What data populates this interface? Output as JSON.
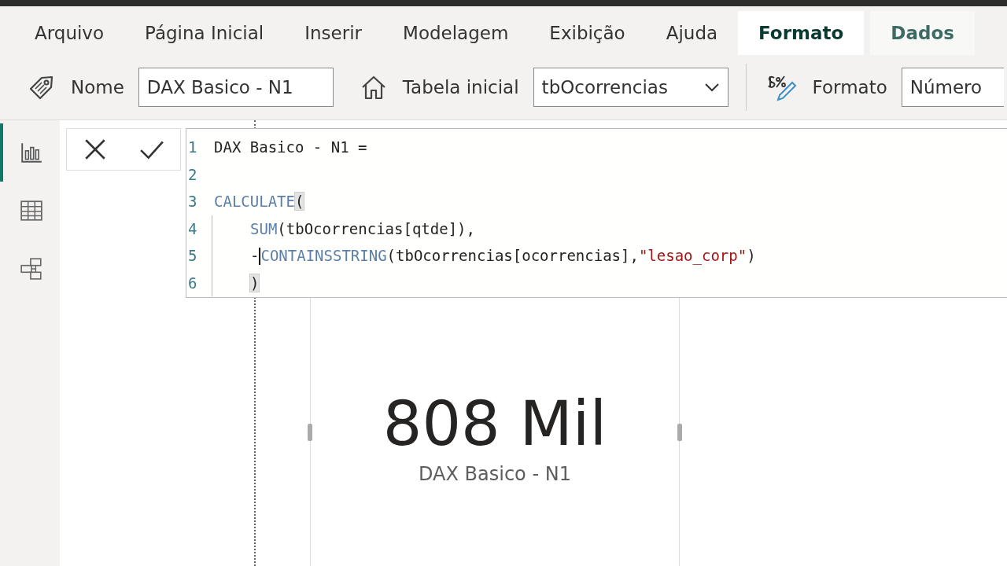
{
  "tabs": [
    {
      "label": "Arquivo",
      "selected": false,
      "contextual": false
    },
    {
      "label": "Página Inicial",
      "selected": false,
      "contextual": false
    },
    {
      "label": "Inserir",
      "selected": false,
      "contextual": false
    },
    {
      "label": "Modelagem",
      "selected": false,
      "contextual": false
    },
    {
      "label": "Exibição",
      "selected": false,
      "contextual": false
    },
    {
      "label": "Ajuda",
      "selected": false,
      "contextual": false
    },
    {
      "label": "Formato",
      "selected": true,
      "contextual": true
    },
    {
      "label": "Dados",
      "selected": false,
      "contextual": true
    }
  ],
  "toolbar": {
    "name_label": "Nome",
    "name_value": "DAX Basico - N1",
    "table_label": "Tabela inicial",
    "table_value": "tbOcorrencias",
    "format_label": "Formato",
    "format_value": "Número"
  },
  "sidebar": [
    {
      "kind": "report",
      "selected": true
    },
    {
      "kind": "data",
      "selected": false
    },
    {
      "kind": "model",
      "selected": false
    }
  ],
  "formula": {
    "lines": [
      {
        "number": "1",
        "indented": false,
        "tokens": [
          {
            "kind": "plain",
            "text": "DAX Basico - N1 ="
          }
        ]
      },
      {
        "number": "2",
        "indented": false
      },
      {
        "number": "3",
        "indented": false,
        "tokens": [
          {
            "kind": "function",
            "text": "CALCULATE"
          },
          {
            "kind": "bracket",
            "text": "("
          }
        ]
      },
      {
        "number": "4",
        "indented": true,
        "tokens": [
          {
            "kind": "function",
            "text": "SUM"
          },
          {
            "kind": "plain",
            "text": "(tbOcorrencias[qtde]),"
          }
        ]
      },
      {
        "number": "5",
        "indented": true,
        "tokens": [
          {
            "kind": "plain",
            "text": "-"
          },
          {
            "kind": "caret"
          },
          {
            "kind": "function",
            "text": "CONTAINSSTRING"
          },
          {
            "kind": "plain",
            "text": "(tbOcorrencias[ocorrencias],"
          },
          {
            "kind": "string",
            "text": "\"lesao_corp\""
          },
          {
            "kind": "plain",
            "text": ")"
          }
        ]
      },
      {
        "number": "6",
        "indented": true,
        "tokens": [
          {
            "kind": "bracket",
            "text": ")"
          }
        ]
      }
    ]
  },
  "card": {
    "value": "808 Mil",
    "label": "DAX Basico - N1"
  }
}
